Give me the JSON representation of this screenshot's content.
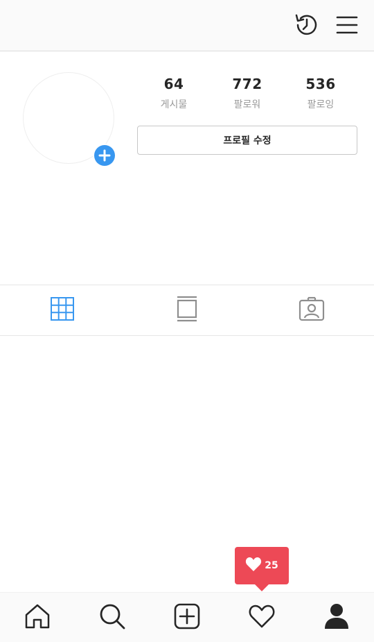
{
  "top_bar": {
    "icons": [
      "history-icon",
      "hamburger-menu-icon"
    ]
  },
  "profile": {
    "avatar_icon": "avatar-placeholder",
    "add_story_icon": "plus-circle-icon",
    "accent_color": "#3897f0",
    "stats": {
      "posts": {
        "count": "64",
        "label": "게시물"
      },
      "followers": {
        "count": "772",
        "label": "팔로워"
      },
      "following": {
        "count": "536",
        "label": "팔로잉"
      }
    },
    "edit_button_label": "프로필 수정"
  },
  "tabs": {
    "items": [
      {
        "name": "grid",
        "icon": "grid-icon",
        "active": true
      },
      {
        "name": "feed",
        "icon": "feed-icon",
        "active": false
      },
      {
        "name": "tagged",
        "icon": "tagged-person-icon",
        "active": false
      }
    ],
    "active_color": "#3897f0"
  },
  "notification": {
    "icon": "heart-icon",
    "count": "25",
    "color": "#ed4956"
  },
  "bottom_nav": {
    "items": [
      {
        "name": "home",
        "icon": "home-icon"
      },
      {
        "name": "search",
        "icon": "search-icon"
      },
      {
        "name": "add",
        "icon": "add-post-icon"
      },
      {
        "name": "activity",
        "icon": "heart-outline-icon"
      },
      {
        "name": "profile",
        "icon": "profile-icon",
        "active": true
      }
    ]
  }
}
